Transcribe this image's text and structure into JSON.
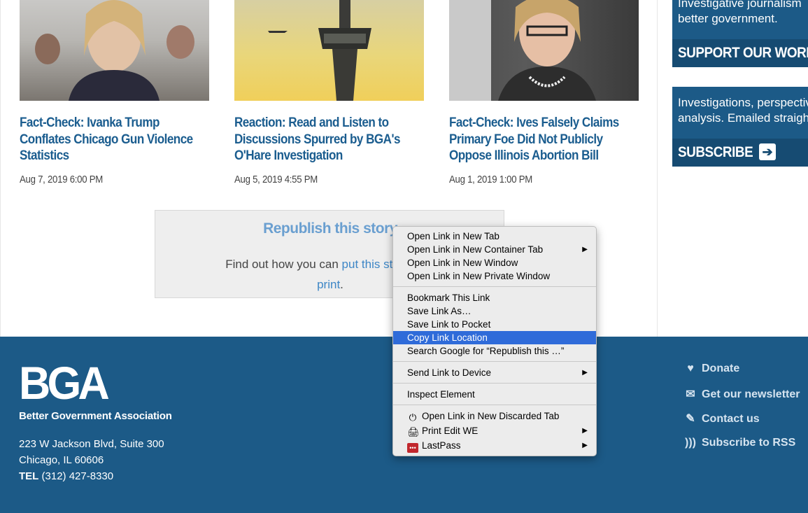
{
  "articles": [
    {
      "title": "Fact-Check: Ivanka Trump Conflates Chicago Gun Violence Statistics",
      "date": "Aug 7, 2019 6:00 PM"
    },
    {
      "title": "Reaction: Read and Listen to Discussions Spurred by BGA's O'Hare Investigation",
      "date": "Aug 5, 2019 4:55 PM"
    },
    {
      "title": "Fact-Check: Ives Falsely Claims Primary Foe Did Not Publicly Oppose Illinois Abortion Bill",
      "date": "Aug 1, 2019 1:00 PM"
    }
  ],
  "republish": {
    "title": "Republish this story",
    "body_prefix": "Find out how you can ",
    "link": "put this story on y",
    "link_cont": "print",
    "suffix": "."
  },
  "sidebar": {
    "support": {
      "line1": "Investigative journalism",
      "line2": "better government.",
      "button": "SUPPORT OUR WORK"
    },
    "subscribe": {
      "line1": "Investigations, perspective",
      "line2": "analysis. Emailed straight",
      "button": "SUBSCRIBE"
    }
  },
  "footer": {
    "logo": "BGA",
    "org": "Better Government Association",
    "address1": "223 W Jackson Blvd, Suite 300",
    "address2": "Chicago, IL 60606",
    "tel_label": "TEL",
    "tel": "(312) 427-8330",
    "links": [
      "Donate",
      "Get our newsletter",
      "Contact us",
      "Subscribe to RSS"
    ]
  },
  "context_menu": {
    "items": [
      "Open Link in New Tab",
      "Open Link in New Container Tab",
      "Open Link in New Window",
      "Open Link in New Private Window",
      "Bookmark This Link",
      "Save Link As…",
      "Save Link to Pocket",
      "Copy Link Location",
      "Search Google for “Republish this …”",
      "Send Link to Device",
      "Inspect Element",
      "Open Link in New Discarded Tab",
      "Print Edit WE",
      "LastPass"
    ],
    "highlighted": "Copy Link Location",
    "colors": {
      "highlight": "#2f6bd9",
      "footer": "#1c5a87",
      "link": "#1b5d8f"
    }
  }
}
